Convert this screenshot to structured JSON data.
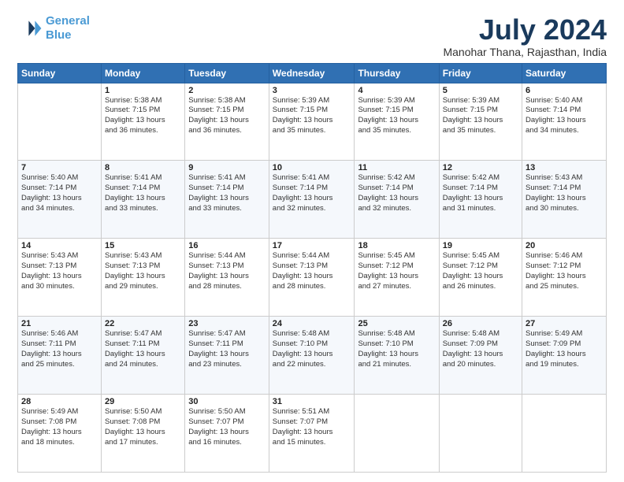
{
  "logo": {
    "line1": "General",
    "line2": "Blue"
  },
  "title": "July 2024",
  "subtitle": "Manohar Thana, Rajasthan, India",
  "header_days": [
    "Sunday",
    "Monday",
    "Tuesday",
    "Wednesday",
    "Thursday",
    "Friday",
    "Saturday"
  ],
  "weeks": [
    [
      {
        "day": "",
        "info": ""
      },
      {
        "day": "1",
        "info": "Sunrise: 5:38 AM\nSunset: 7:15 PM\nDaylight: 13 hours\nand 36 minutes."
      },
      {
        "day": "2",
        "info": "Sunrise: 5:38 AM\nSunset: 7:15 PM\nDaylight: 13 hours\nand 36 minutes."
      },
      {
        "day": "3",
        "info": "Sunrise: 5:39 AM\nSunset: 7:15 PM\nDaylight: 13 hours\nand 35 minutes."
      },
      {
        "day": "4",
        "info": "Sunrise: 5:39 AM\nSunset: 7:15 PM\nDaylight: 13 hours\nand 35 minutes."
      },
      {
        "day": "5",
        "info": "Sunrise: 5:39 AM\nSunset: 7:15 PM\nDaylight: 13 hours\nand 35 minutes."
      },
      {
        "day": "6",
        "info": "Sunrise: 5:40 AM\nSunset: 7:14 PM\nDaylight: 13 hours\nand 34 minutes."
      }
    ],
    [
      {
        "day": "7",
        "info": "Sunrise: 5:40 AM\nSunset: 7:14 PM\nDaylight: 13 hours\nand 34 minutes."
      },
      {
        "day": "8",
        "info": "Sunrise: 5:41 AM\nSunset: 7:14 PM\nDaylight: 13 hours\nand 33 minutes."
      },
      {
        "day": "9",
        "info": "Sunrise: 5:41 AM\nSunset: 7:14 PM\nDaylight: 13 hours\nand 33 minutes."
      },
      {
        "day": "10",
        "info": "Sunrise: 5:41 AM\nSunset: 7:14 PM\nDaylight: 13 hours\nand 32 minutes."
      },
      {
        "day": "11",
        "info": "Sunrise: 5:42 AM\nSunset: 7:14 PM\nDaylight: 13 hours\nand 32 minutes."
      },
      {
        "day": "12",
        "info": "Sunrise: 5:42 AM\nSunset: 7:14 PM\nDaylight: 13 hours\nand 31 minutes."
      },
      {
        "day": "13",
        "info": "Sunrise: 5:43 AM\nSunset: 7:14 PM\nDaylight: 13 hours\nand 30 minutes."
      }
    ],
    [
      {
        "day": "14",
        "info": "Sunrise: 5:43 AM\nSunset: 7:13 PM\nDaylight: 13 hours\nand 30 minutes."
      },
      {
        "day": "15",
        "info": "Sunrise: 5:43 AM\nSunset: 7:13 PM\nDaylight: 13 hours\nand 29 minutes."
      },
      {
        "day": "16",
        "info": "Sunrise: 5:44 AM\nSunset: 7:13 PM\nDaylight: 13 hours\nand 28 minutes."
      },
      {
        "day": "17",
        "info": "Sunrise: 5:44 AM\nSunset: 7:13 PM\nDaylight: 13 hours\nand 28 minutes."
      },
      {
        "day": "18",
        "info": "Sunrise: 5:45 AM\nSunset: 7:12 PM\nDaylight: 13 hours\nand 27 minutes."
      },
      {
        "day": "19",
        "info": "Sunrise: 5:45 AM\nSunset: 7:12 PM\nDaylight: 13 hours\nand 26 minutes."
      },
      {
        "day": "20",
        "info": "Sunrise: 5:46 AM\nSunset: 7:12 PM\nDaylight: 13 hours\nand 25 minutes."
      }
    ],
    [
      {
        "day": "21",
        "info": "Sunrise: 5:46 AM\nSunset: 7:11 PM\nDaylight: 13 hours\nand 25 minutes."
      },
      {
        "day": "22",
        "info": "Sunrise: 5:47 AM\nSunset: 7:11 PM\nDaylight: 13 hours\nand 24 minutes."
      },
      {
        "day": "23",
        "info": "Sunrise: 5:47 AM\nSunset: 7:11 PM\nDaylight: 13 hours\nand 23 minutes."
      },
      {
        "day": "24",
        "info": "Sunrise: 5:48 AM\nSunset: 7:10 PM\nDaylight: 13 hours\nand 22 minutes."
      },
      {
        "day": "25",
        "info": "Sunrise: 5:48 AM\nSunset: 7:10 PM\nDaylight: 13 hours\nand 21 minutes."
      },
      {
        "day": "26",
        "info": "Sunrise: 5:48 AM\nSunset: 7:09 PM\nDaylight: 13 hours\nand 20 minutes."
      },
      {
        "day": "27",
        "info": "Sunrise: 5:49 AM\nSunset: 7:09 PM\nDaylight: 13 hours\nand 19 minutes."
      }
    ],
    [
      {
        "day": "28",
        "info": "Sunrise: 5:49 AM\nSunset: 7:08 PM\nDaylight: 13 hours\nand 18 minutes."
      },
      {
        "day": "29",
        "info": "Sunrise: 5:50 AM\nSunset: 7:08 PM\nDaylight: 13 hours\nand 17 minutes."
      },
      {
        "day": "30",
        "info": "Sunrise: 5:50 AM\nSunset: 7:07 PM\nDaylight: 13 hours\nand 16 minutes."
      },
      {
        "day": "31",
        "info": "Sunrise: 5:51 AM\nSunset: 7:07 PM\nDaylight: 13 hours\nand 15 minutes."
      },
      {
        "day": "",
        "info": ""
      },
      {
        "day": "",
        "info": ""
      },
      {
        "day": "",
        "info": ""
      }
    ]
  ]
}
